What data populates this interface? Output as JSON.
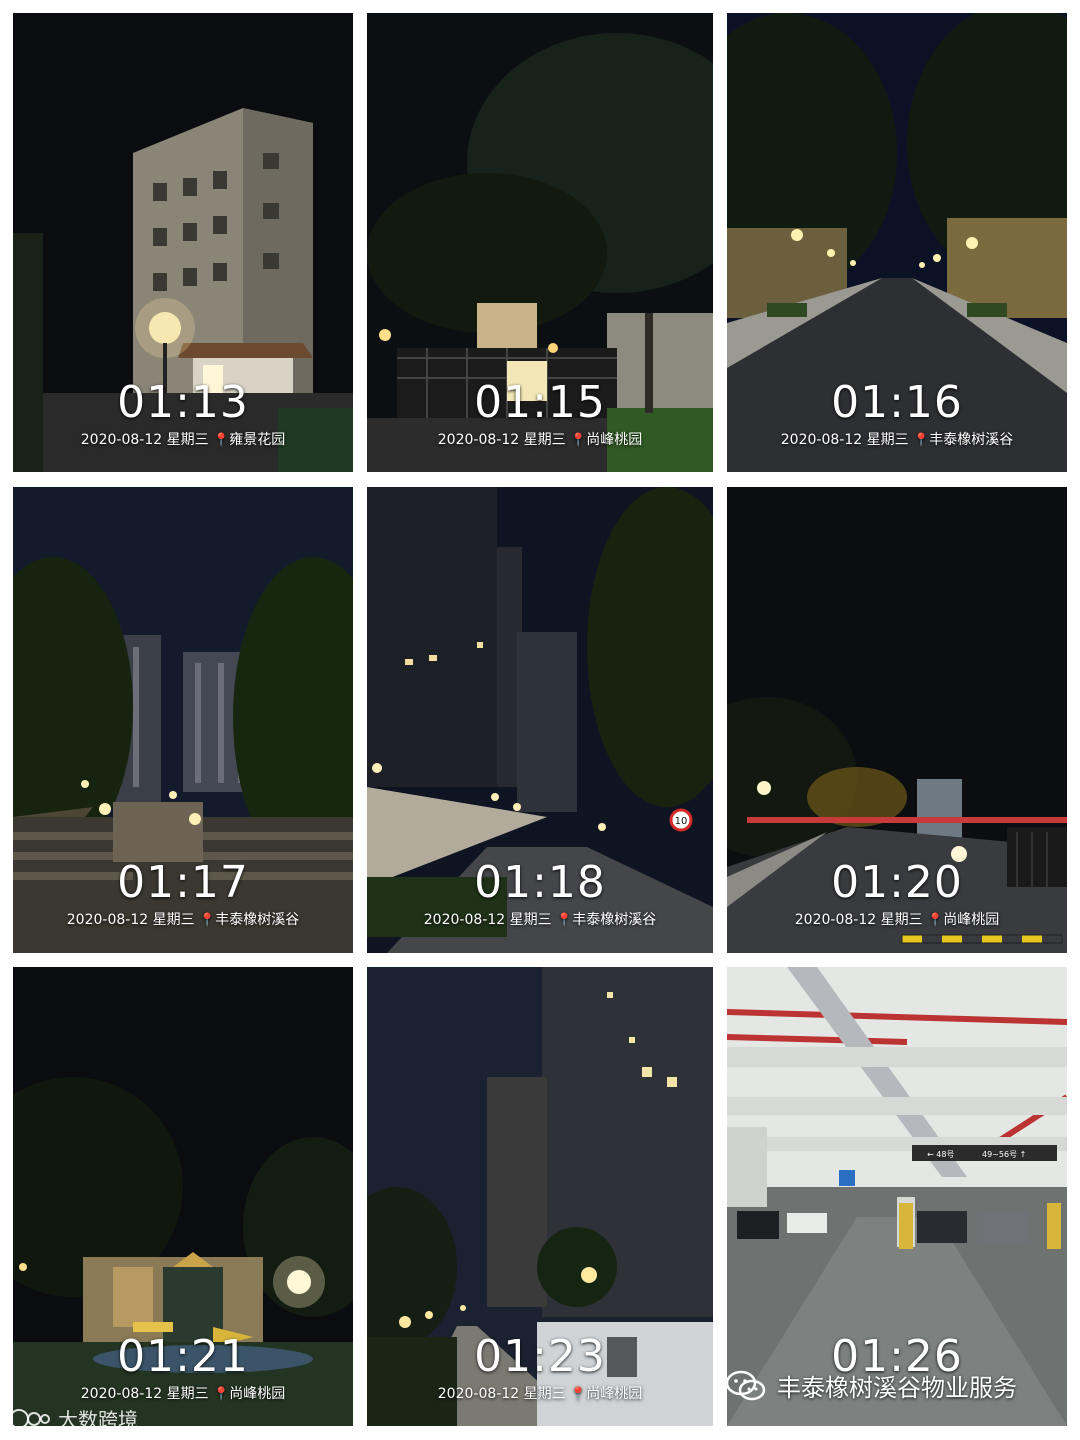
{
  "photos": [
    {
      "time": "01:13",
      "date": "2020-08-12",
      "weekday": "星期三",
      "place": "雍景花园"
    },
    {
      "time": "01:15",
      "date": "2020-08-12",
      "weekday": "星期三",
      "place": "尚峰桃园"
    },
    {
      "time": "01:16",
      "date": "2020-08-12",
      "weekday": "星期三",
      "place": "丰泰橡树溪谷"
    },
    {
      "time": "01:17",
      "date": "2020-08-12",
      "weekday": "星期三",
      "place": "丰泰橡树溪谷"
    },
    {
      "time": "01:18",
      "date": "2020-08-12",
      "weekday": "星期三",
      "place": "丰泰橡树溪谷"
    },
    {
      "time": "01:20",
      "date": "2020-08-12",
      "weekday": "星期三",
      "place": "尚峰桃园"
    },
    {
      "time": "01:21",
      "date": "2020-08-12",
      "weekday": "星期三",
      "place": "尚峰桃园"
    },
    {
      "time": "01:23",
      "date": "2020-08-12",
      "weekday": "星期三",
      "place": "尚峰桃园"
    },
    {
      "time": "01:26",
      "date": "",
      "weekday": "",
      "place": ""
    }
  ],
  "overlay": {
    "wechat_account": "丰泰橡树溪谷物业服务",
    "watermark": "大数跨境"
  },
  "signs": {
    "speed_limit": "10",
    "parking_direction_left": "← 48号",
    "parking_direction_right": "49~56号 ↑"
  }
}
